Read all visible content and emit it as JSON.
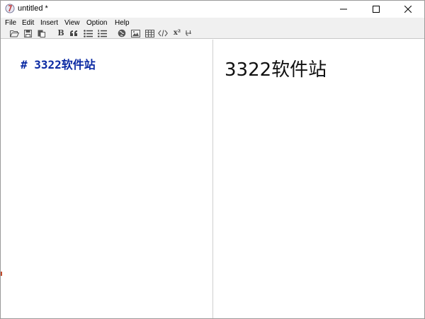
{
  "window": {
    "title": "untitled *"
  },
  "menu": {
    "file": "File",
    "edit": "Edit",
    "insert": "Insert",
    "view": "View",
    "option": "Option",
    "help": "Help"
  },
  "toolbar": {
    "icons": [
      "open-icon",
      "save-icon",
      "paste-icon",
      "bold-icon",
      "quote-icon",
      "bullet-list-icon",
      "numbered-list-icon",
      "link-icon",
      "image-icon",
      "table-icon",
      "code-icon",
      "superscript-icon",
      "strikethrough-icon"
    ],
    "bold_label": "B",
    "superscript_label": "x²",
    "strike_label": "ᵦ"
  },
  "editor": {
    "line1": "# 3322软件站"
  },
  "preview": {
    "heading": "3322软件站"
  },
  "colors": {
    "editor_text": "#0b2aa3",
    "chrome": "#f0f0f0"
  }
}
